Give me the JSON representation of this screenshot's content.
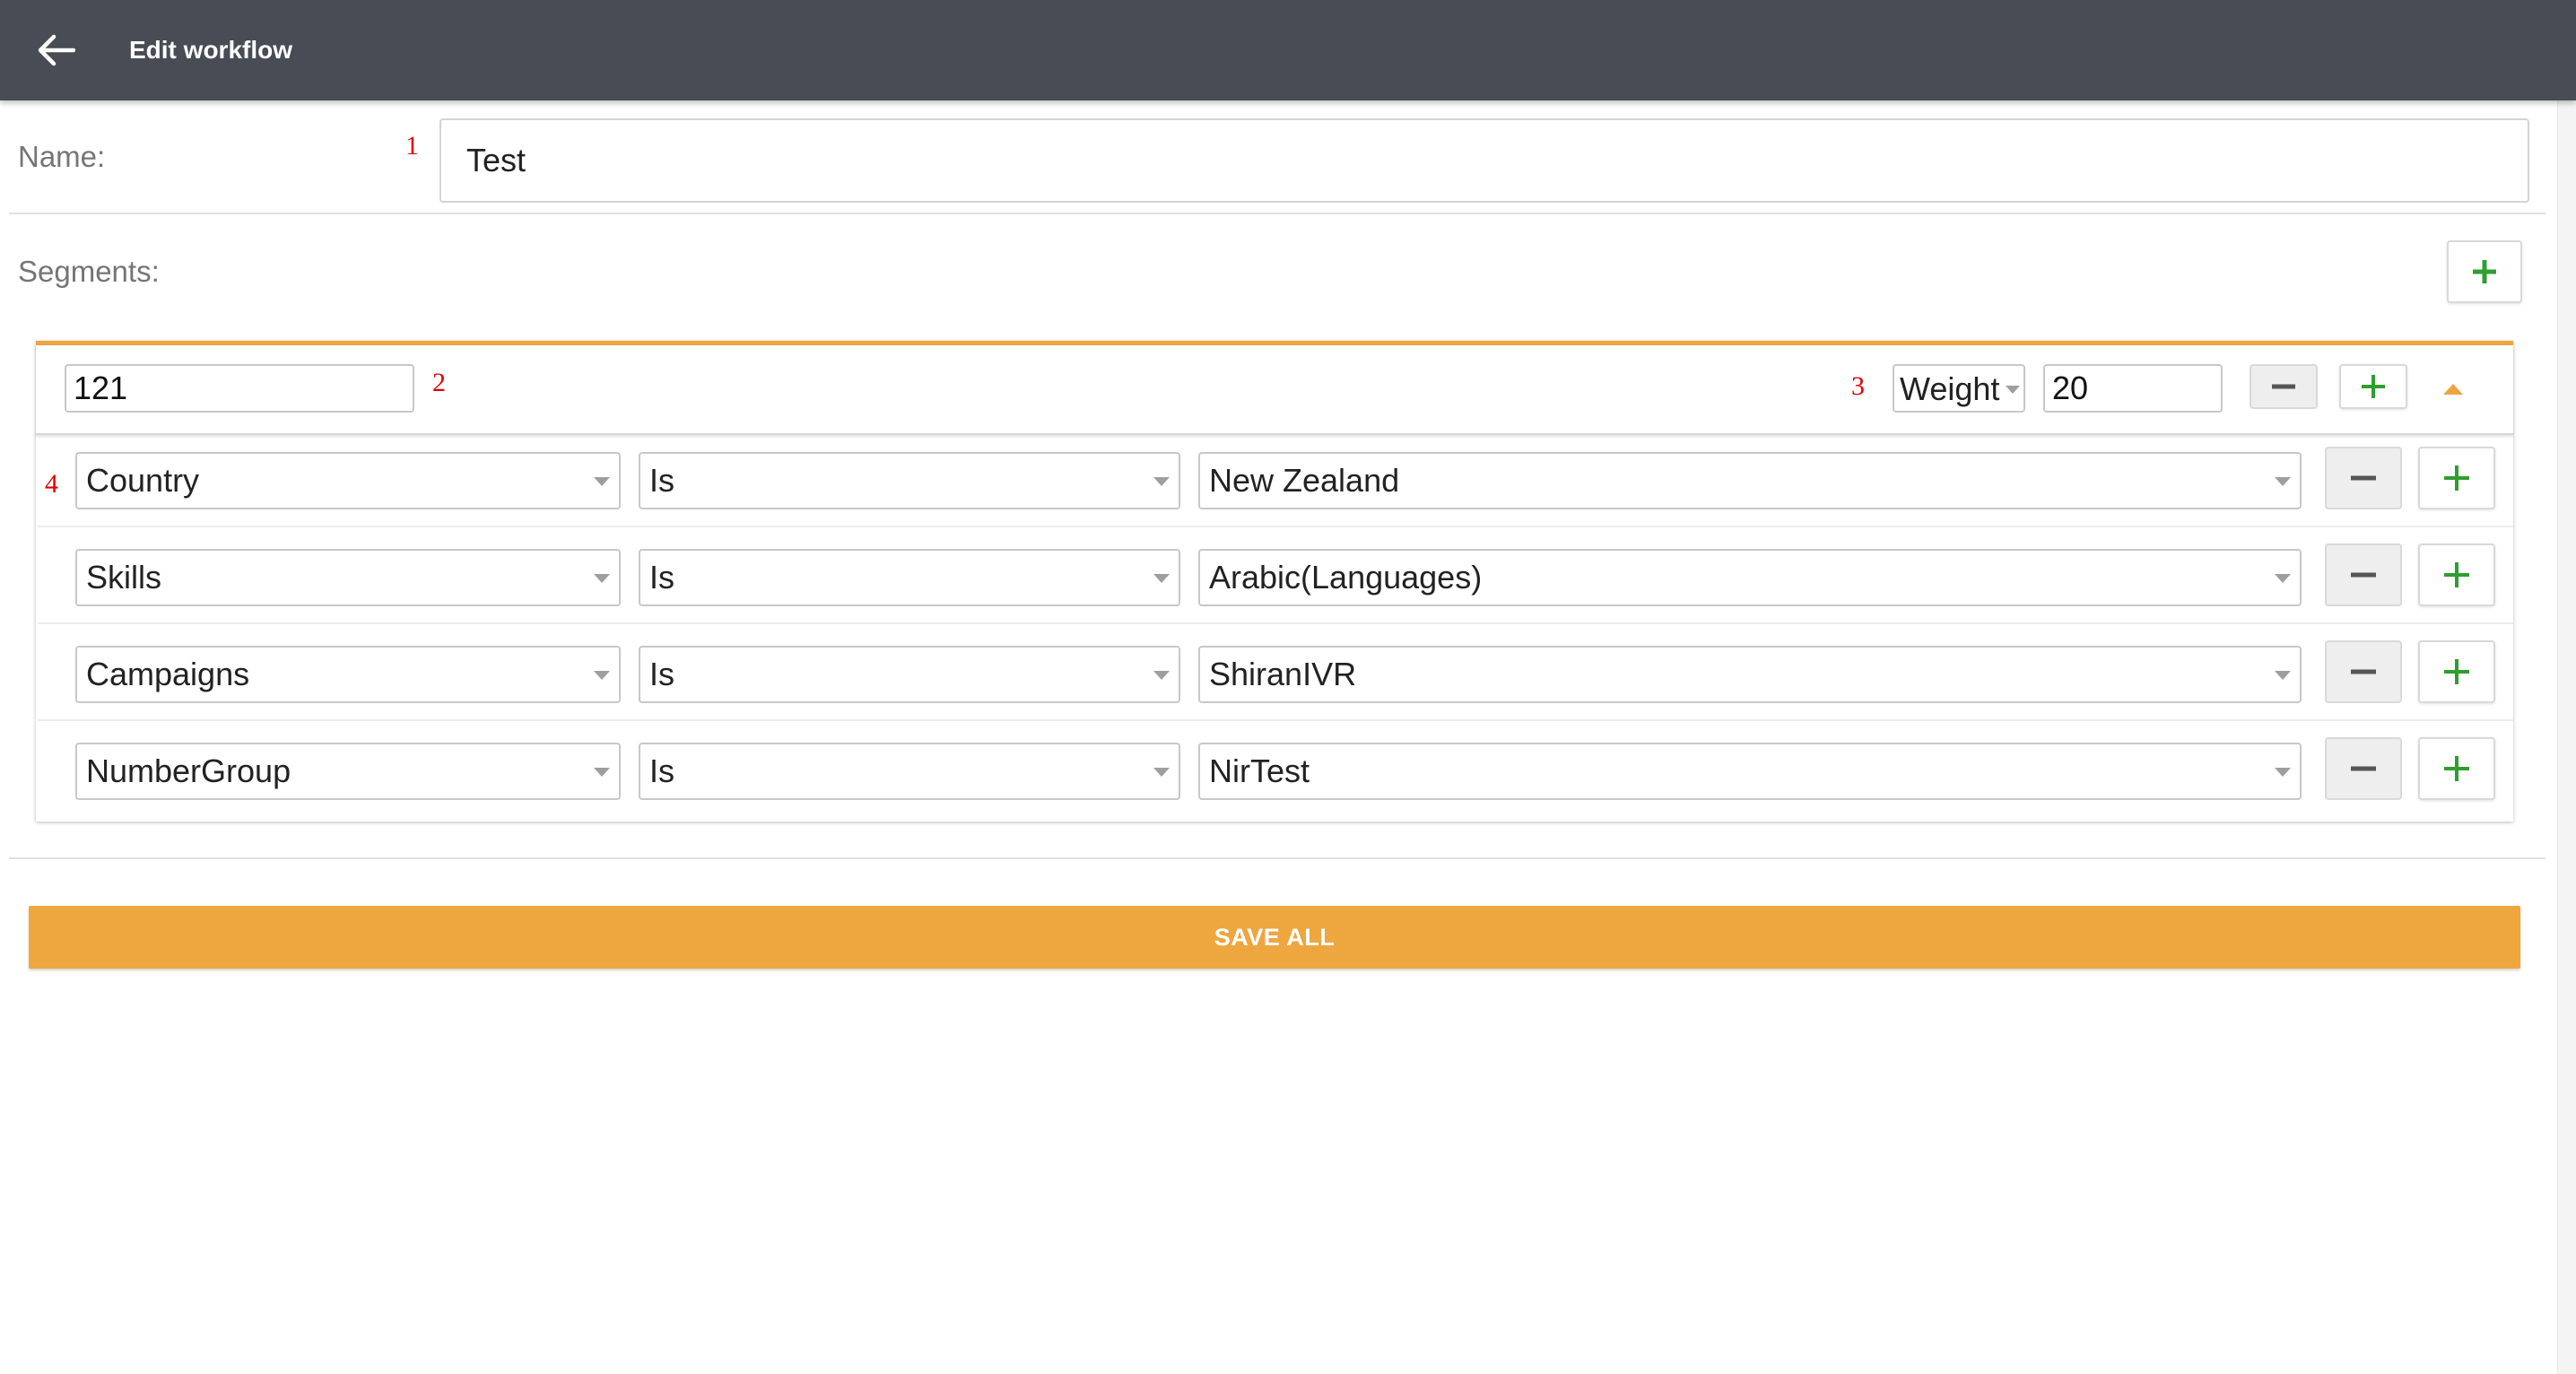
{
  "header": {
    "title": "Edit workflow"
  },
  "markers": [
    "1",
    "2",
    "3",
    "4"
  ],
  "form": {
    "name_label": "Name:",
    "name_value": "Test",
    "segments_label": "Segments:"
  },
  "segment": {
    "name_value": "121",
    "type_select": "Weight",
    "weight_value": "20",
    "rules": [
      {
        "field": "Country",
        "operator": "Is",
        "value": "New Zealand"
      },
      {
        "field": "Skills",
        "operator": "Is",
        "value": "Arabic(Languages)"
      },
      {
        "field": "Campaigns",
        "operator": "Is",
        "value": "ShiranIVR"
      },
      {
        "field": "NumberGroup",
        "operator": "Is",
        "value": "NirTest"
      }
    ]
  },
  "actions": {
    "save_label": "SAVE ALL"
  },
  "colors": {
    "appbar": "#474c55",
    "accent": "#eea43f",
    "plus": "#2e9e2e",
    "minus": "#555555",
    "marker": "#e00000"
  },
  "icons": {
    "back": "arrow-left-icon",
    "add": "plus-icon",
    "remove": "minus-icon",
    "dropdown": "caret-down-icon",
    "collapse": "caret-up-icon"
  }
}
